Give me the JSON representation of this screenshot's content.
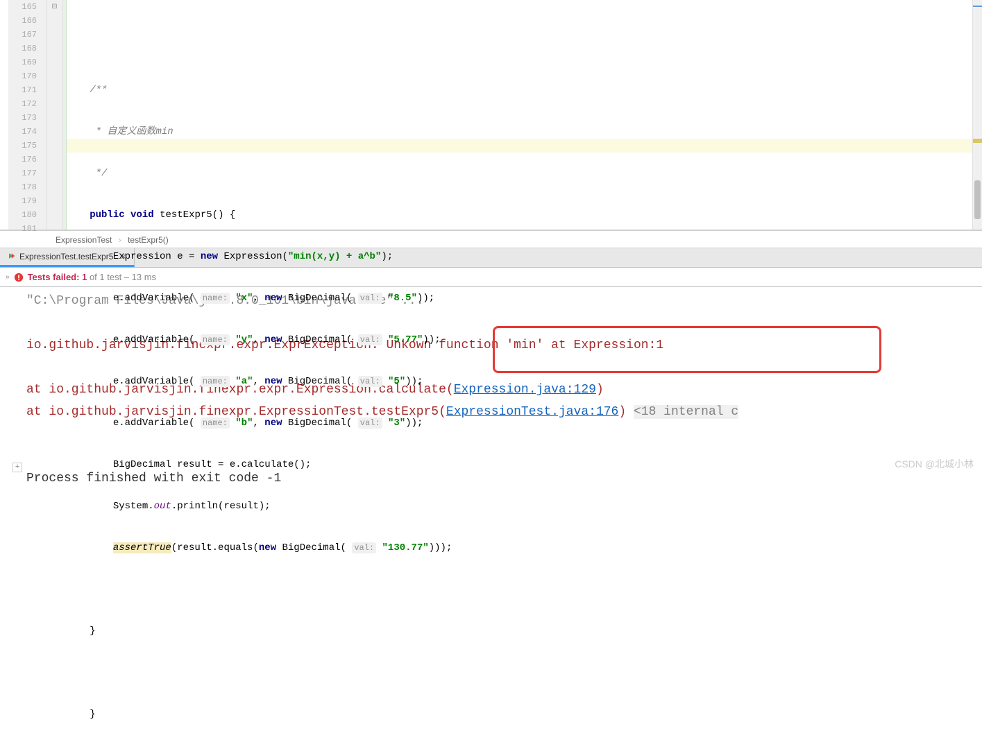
{
  "code": {
    "lines": [
      {
        "n": "165",
        "fold": true
      },
      {
        "n": "166"
      },
      {
        "n": "167"
      },
      {
        "n": "168"
      },
      {
        "n": "169",
        "run": true,
        "fold": true
      },
      {
        "n": "170"
      },
      {
        "n": "171"
      },
      {
        "n": "172"
      },
      {
        "n": "173"
      },
      {
        "n": "174"
      },
      {
        "n": "175",
        "highlight": true
      },
      {
        "n": "176"
      },
      {
        "n": "177"
      },
      {
        "n": "178"
      },
      {
        "n": "179"
      },
      {
        "n": "180"
      },
      {
        "n": "181"
      }
    ],
    "tokens": {
      "comment1": "/**",
      "comment2": " * 自定义函数min",
      "comment3": " */",
      "kw_public": "public",
      "kw_void": "void",
      "method": "testExpr5() {",
      "expr_type": "Expression e = ",
      "kw_new": "new",
      "expr_ctor": "Expression(",
      "str_minexpr": "\"min(x,y) + a^b\"",
      "rparen_semi": ");",
      "addvar": "e.addVariable(",
      "hint_name": "name:",
      "hint_val": "val:",
      "str_x": "\"x\"",
      "str_y": "\"y\"",
      "str_a": "\"a\"",
      "str_b": "\"b\"",
      "str_85": "\"8.5\"",
      "str_577": "\"5.77\"",
      "str_5": "\"5\"",
      "str_3": "\"3\"",
      "bigdec": "BigDecimal(",
      "comma_new": ", ",
      "l175": "BigDecimal result = e.calculate();",
      "sys_pre": "System.",
      "out": "out",
      "sys_post": ".println(result);",
      "assertTrue": "assertTrue",
      "assert_rest": "(result.equals(",
      "str_13077": "\"130.77\"",
      "close3": ")));",
      "close2": "));",
      "close_brace": "}"
    }
  },
  "breadcrumb": {
    "a": "ExpressionTest",
    "b": "testExpr5()"
  },
  "tab": {
    "label": "ExpressionTest.testExpr5"
  },
  "status": {
    "fail_prefix": "Tests failed:",
    "fail_count": "1",
    "rest": "of 1 test – 13 ms"
  },
  "console": {
    "line1_pre": "\"C:\\Program Files\\Java\\jdk1.8.0_101\\bin\\java.exe\" ",
    "line1_dots": "...",
    "exc_prefix": "io.github.jarvisjin.finexpr.expr.ExprException: ",
    "exc_msg": "Unkown function 'min' at Expression:1",
    "at1_pre": "    at io.github.jarvisjin.finexpr.expr.Expression.calculate(",
    "at1_link": "Expression.java:129",
    "at1_post": ")",
    "at2_pre": "    at io.github.jarvisjin.finexpr.ExpressionTest.testExpr5(",
    "at2_link": "ExpressionTest.java:176",
    "at2_post": ") ",
    "at2_gray": "<18 internal c",
    "proc": "Process finished with exit code -1"
  },
  "watermark": "CSDN @北城小林"
}
